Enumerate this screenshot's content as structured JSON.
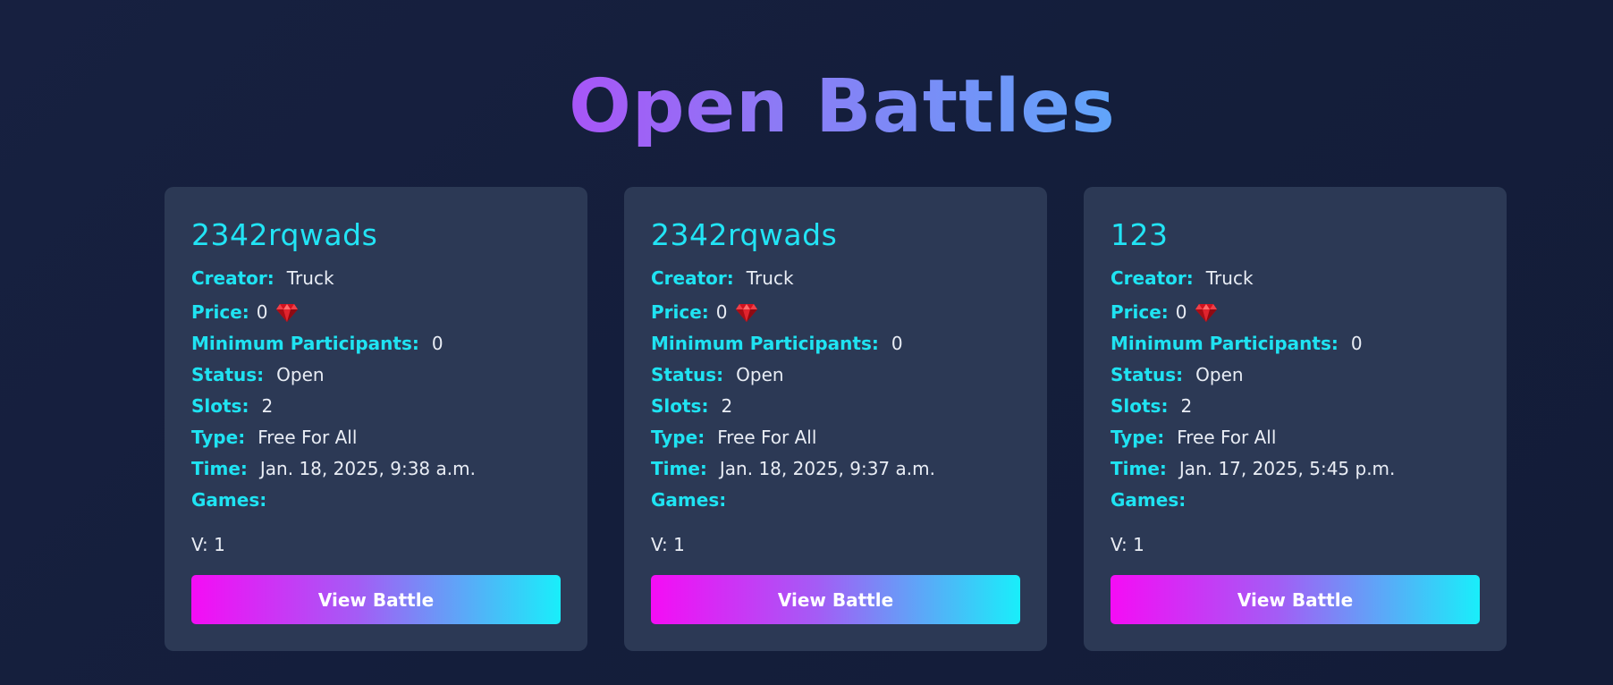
{
  "page": {
    "title": "Open Battles"
  },
  "labels": {
    "creator": "Creator:",
    "price": "Price:",
    "min_participants": "Minimum Participants:",
    "status": "Status:",
    "slots": "Slots:",
    "type": "Type:",
    "time": "Time:",
    "games": "Games:",
    "view_button": "View Battle"
  },
  "battles": [
    {
      "name": "2342rqwads",
      "creator": "Truck",
      "price": "0",
      "min_participants": "0",
      "status": "Open",
      "slots": "2",
      "type": "Free For All",
      "time": "Jan. 18, 2025, 9:38 a.m.",
      "games": "",
      "version": "V: 1"
    },
    {
      "name": "2342rqwads",
      "creator": "Truck",
      "price": "0",
      "min_participants": "0",
      "status": "Open",
      "slots": "2",
      "type": "Free For All",
      "time": "Jan. 18, 2025, 9:37 a.m.",
      "games": "",
      "version": "V: 1"
    },
    {
      "name": "123",
      "creator": "Truck",
      "price": "0",
      "min_participants": "0",
      "status": "Open",
      "slots": "2",
      "type": "Free For All",
      "time": "Jan. 17, 2025, 5:45 p.m.",
      "games": "",
      "version": "V: 1"
    }
  ],
  "icons": {
    "price_currency": "gem-icon"
  },
  "colors": {
    "accent_cyan": "#1fe3f2",
    "card_bg": "#2c3955",
    "button_gradient_start": "#f50cf5",
    "button_gradient_end": "#19eefa"
  }
}
